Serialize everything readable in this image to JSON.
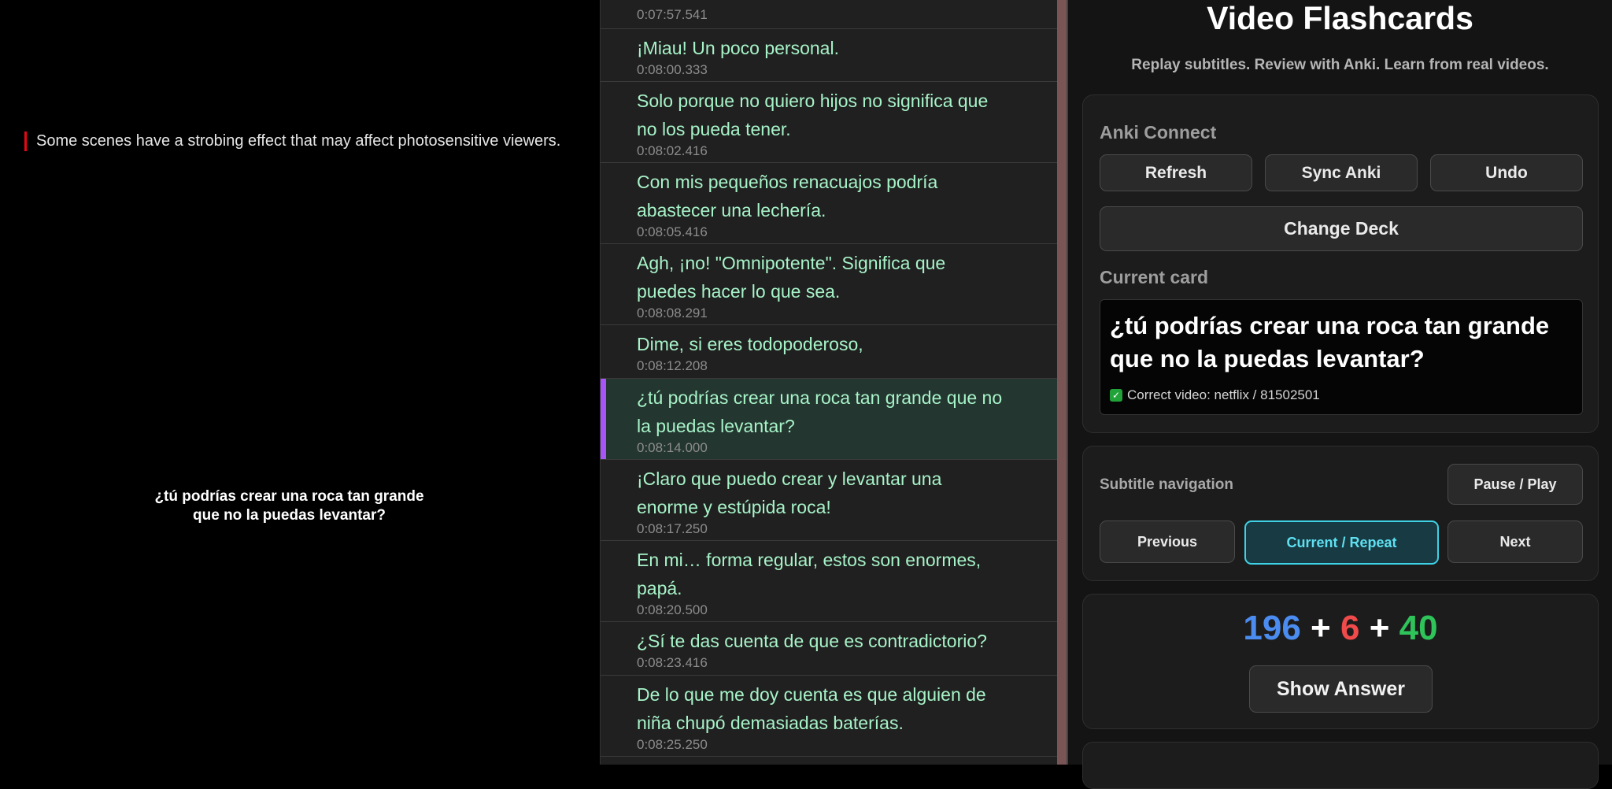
{
  "video": {
    "warning": "Some scenes have a strobing effect that may affect photosensitive viewers.",
    "subtitle_lines": [
      "¿tú podrías crear una roca tan grande",
      "que no la puedas levantar?"
    ]
  },
  "subtitles": [
    {
      "text": "",
      "time": "0:07:57.541"
    },
    {
      "text": "¡Miau! Un poco personal.",
      "time": "0:08:00.333"
    },
    {
      "text": "Solo porque no quiero hijos no significa que no los pueda tener.",
      "time": "0:08:02.416"
    },
    {
      "text": "Con mis pequeños renacuajos podría abastecer una lechería.",
      "time": "0:08:05.416"
    },
    {
      "text": "Agh, ¡no! \"Omnipotente\". Significa que puedes hacer lo que sea.",
      "time": "0:08:08.291"
    },
    {
      "text": "Dime, si eres todopoderoso,",
      "time": "0:08:12.208"
    },
    {
      "text": "¿tú podrías crear una roca tan grande que no la puedas levantar?",
      "time": "0:08:14.000",
      "active": true
    },
    {
      "text": "¡Claro que puedo crear y levantar una enorme y estúpida roca!",
      "time": "0:08:17.250"
    },
    {
      "text": "En mi… forma regular, estos son enormes, papá.",
      "time": "0:08:20.500"
    },
    {
      "text": "¿Sí te das cuenta de que es contradictorio?",
      "time": "0:08:23.416"
    },
    {
      "text": "De lo que me doy cuenta es que alguien de niña chupó demasiadas baterías.",
      "time": "0:08:25.250"
    }
  ],
  "panel": {
    "title": "Video Flashcards",
    "tagline": "Replay subtitles. Review with Anki. Learn from real videos.",
    "anki": {
      "heading": "Anki Connect",
      "refresh": "Refresh",
      "sync": "Sync Anki",
      "undo": "Undo",
      "change_deck": "Change Deck",
      "current_heading": "Current card",
      "card_text": "¿tú podrías crear una roca tan grande que no la puedas levantar?",
      "status_text": "Correct video: netflix / 81502501"
    },
    "nav": {
      "heading": "Subtitle navigation",
      "pause_play": "Pause / Play",
      "previous": "Previous",
      "current_repeat": "Current / Repeat",
      "next": "Next"
    },
    "review": {
      "new_count": "196",
      "plus1": "+",
      "learn_count": "6",
      "plus2": "+",
      "due_count": "40",
      "show_answer": "Show Answer"
    }
  },
  "colors": {
    "accent_red": "#e50914",
    "active_bar": "#a855f7",
    "subtitle_text": "#a7f3c8",
    "new_blue": "#4a8cf0",
    "learn_red": "#f04a4a",
    "due_green": "#2ec45a",
    "current_cyan": "#3fd2e6"
  }
}
